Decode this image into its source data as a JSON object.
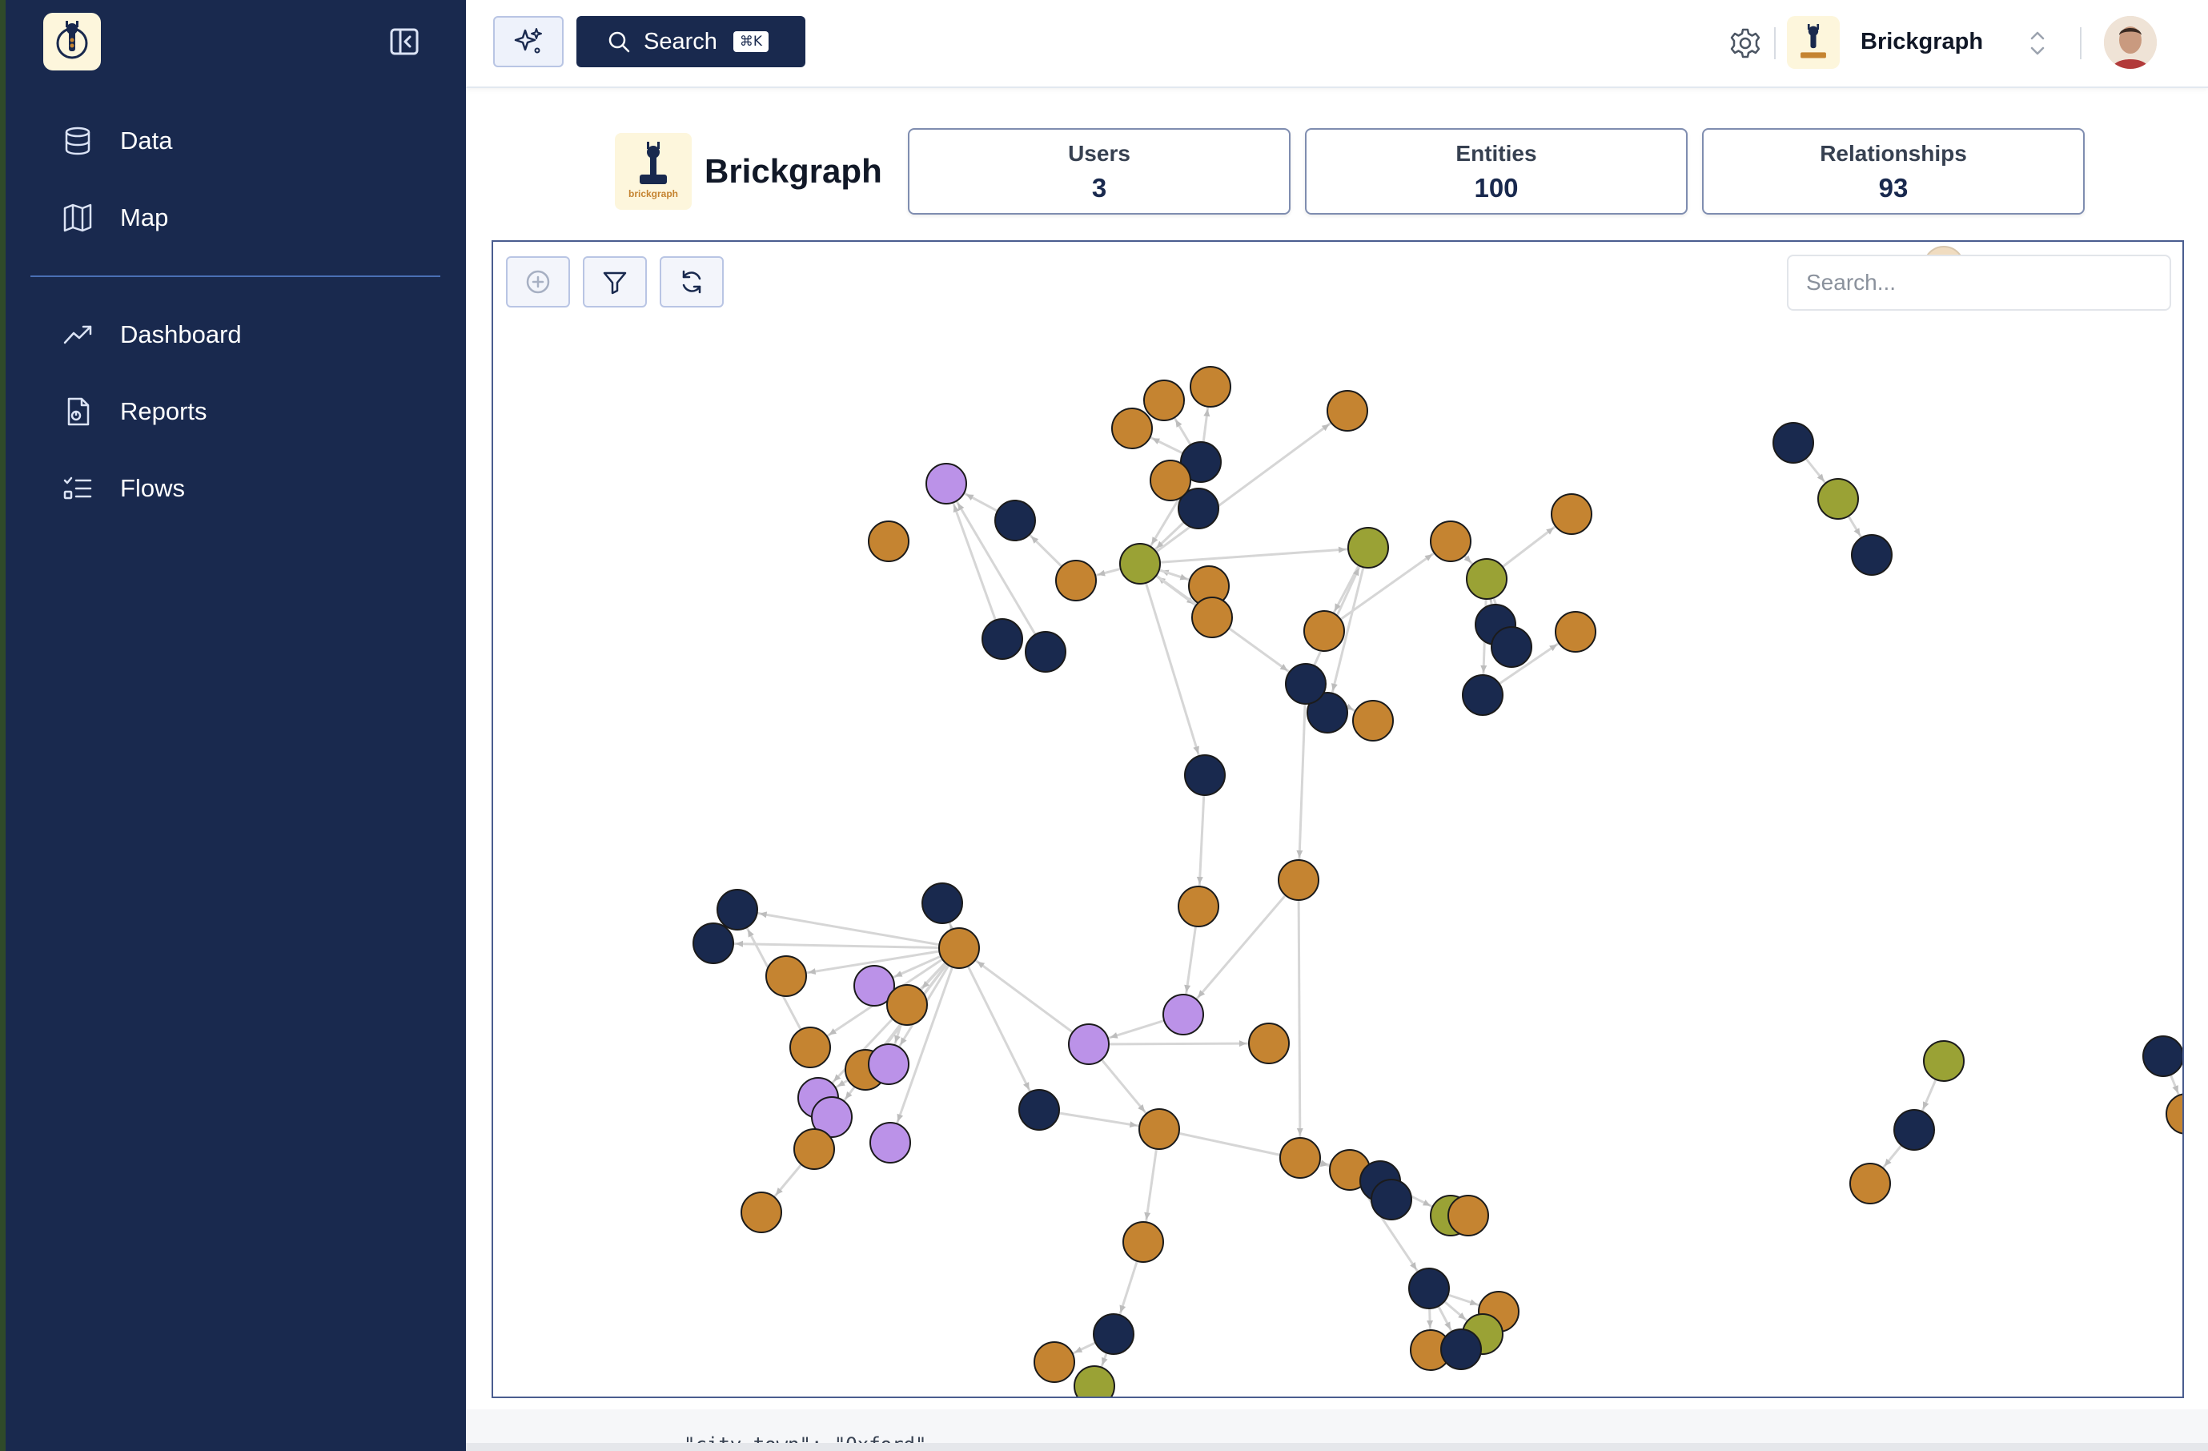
{
  "sidebar": {
    "items_top": [
      {
        "label": "Data",
        "icon": "database-icon"
      },
      {
        "label": "Map",
        "icon": "map-icon"
      }
    ],
    "items_bottom": [
      {
        "label": "Dashboard",
        "icon": "trending-up-icon"
      },
      {
        "label": "Reports",
        "icon": "file-chart-icon"
      },
      {
        "label": "Flows",
        "icon": "list-checks-icon"
      }
    ]
  },
  "topbar": {
    "search_label": "Search",
    "search_shortcut": "⌘K",
    "workspace_name": "Brickgraph"
  },
  "header": {
    "brand_name": "Brickgraph",
    "logo_caption": "brickgraph",
    "stats": [
      {
        "label": "Users",
        "value": "3"
      },
      {
        "label": "Entities",
        "value": "100"
      },
      {
        "label": "Relationships",
        "value": "93"
      }
    ]
  },
  "graph": {
    "search_placeholder": "Search...",
    "colors": {
      "entity_navy": "#19294e",
      "entity_amber": "#c58431",
      "entity_olive": "#9aa235",
      "entity_lavender": "#bb92e8",
      "edge": "#d6d6d6"
    }
  },
  "footer": {
    "code_text": "\"city_town\": \"Oxford\""
  }
}
